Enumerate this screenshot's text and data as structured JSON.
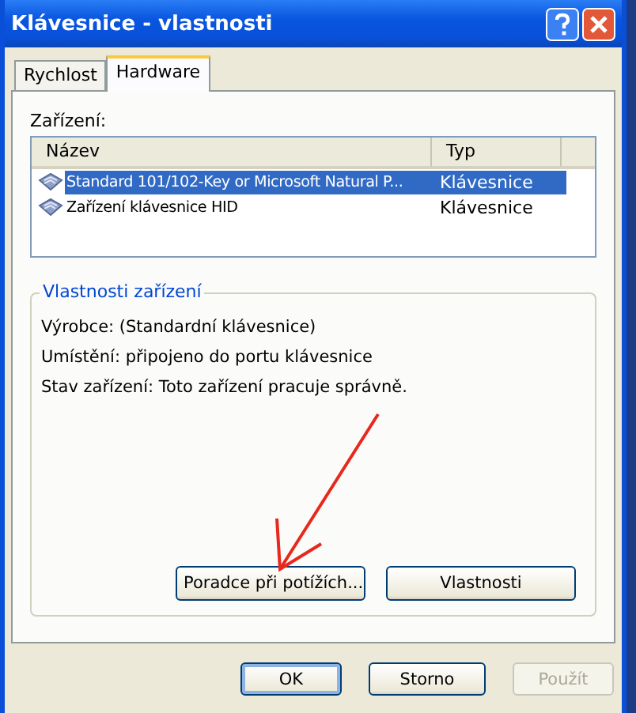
{
  "window": {
    "title": "Klávesnice - vlastnosti"
  },
  "tabs": [
    {
      "label": "Rychlost",
      "selected": false
    },
    {
      "label": "Hardware",
      "selected": true
    }
  ],
  "devices": {
    "label": "Zařízení:",
    "columns": [
      "Název",
      "Typ"
    ],
    "rows": [
      {
        "name": "Standard 101/102-Key or Microsoft Natural P...",
        "type": "Klávesnice",
        "selected": true
      },
      {
        "name": "Zařízení klávesnice HID",
        "type": "Klávesnice",
        "selected": false
      }
    ]
  },
  "properties": {
    "title": "Vlastnosti zařízení",
    "lines": [
      "Výrobce: (Standardní klávesnice)",
      "Umístění: připojeno do portu klávesnice",
      "Stav zařízení: Toto zařízení pracuje správně."
    ],
    "buttons": [
      {
        "label": "Poradce při potížích...",
        "disabled": false
      },
      {
        "label": "Vlastnosti",
        "disabled": false
      }
    ]
  },
  "buttons": [
    {
      "label": "OK",
      "disabled": false,
      "default": true
    },
    {
      "label": "Storno",
      "disabled": false,
      "default": false
    },
    {
      "label": "Použít",
      "disabled": true,
      "default": false
    }
  ]
}
